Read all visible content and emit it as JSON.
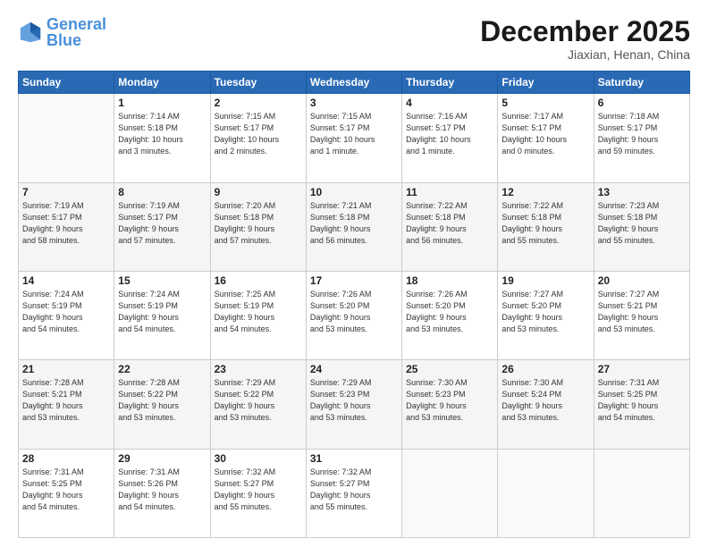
{
  "logo": {
    "line1": "General",
    "line2": "Blue"
  },
  "title": "December 2025",
  "subtitle": "Jiaxian, Henan, China",
  "weekdays": [
    "Sunday",
    "Monday",
    "Tuesday",
    "Wednesday",
    "Thursday",
    "Friday",
    "Saturday"
  ],
  "rows": [
    [
      {
        "num": "",
        "detail": ""
      },
      {
        "num": "1",
        "detail": "Sunrise: 7:14 AM\nSunset: 5:18 PM\nDaylight: 10 hours\nand 3 minutes."
      },
      {
        "num": "2",
        "detail": "Sunrise: 7:15 AM\nSunset: 5:17 PM\nDaylight: 10 hours\nand 2 minutes."
      },
      {
        "num": "3",
        "detail": "Sunrise: 7:15 AM\nSunset: 5:17 PM\nDaylight: 10 hours\nand 1 minute."
      },
      {
        "num": "4",
        "detail": "Sunrise: 7:16 AM\nSunset: 5:17 PM\nDaylight: 10 hours\nand 1 minute."
      },
      {
        "num": "5",
        "detail": "Sunrise: 7:17 AM\nSunset: 5:17 PM\nDaylight: 10 hours\nand 0 minutes."
      },
      {
        "num": "6",
        "detail": "Sunrise: 7:18 AM\nSunset: 5:17 PM\nDaylight: 9 hours\nand 59 minutes."
      }
    ],
    [
      {
        "num": "7",
        "detail": "Sunrise: 7:19 AM\nSunset: 5:17 PM\nDaylight: 9 hours\nand 58 minutes."
      },
      {
        "num": "8",
        "detail": "Sunrise: 7:19 AM\nSunset: 5:17 PM\nDaylight: 9 hours\nand 57 minutes."
      },
      {
        "num": "9",
        "detail": "Sunrise: 7:20 AM\nSunset: 5:18 PM\nDaylight: 9 hours\nand 57 minutes."
      },
      {
        "num": "10",
        "detail": "Sunrise: 7:21 AM\nSunset: 5:18 PM\nDaylight: 9 hours\nand 56 minutes."
      },
      {
        "num": "11",
        "detail": "Sunrise: 7:22 AM\nSunset: 5:18 PM\nDaylight: 9 hours\nand 56 minutes."
      },
      {
        "num": "12",
        "detail": "Sunrise: 7:22 AM\nSunset: 5:18 PM\nDaylight: 9 hours\nand 55 minutes."
      },
      {
        "num": "13",
        "detail": "Sunrise: 7:23 AM\nSunset: 5:18 PM\nDaylight: 9 hours\nand 55 minutes."
      }
    ],
    [
      {
        "num": "14",
        "detail": "Sunrise: 7:24 AM\nSunset: 5:19 PM\nDaylight: 9 hours\nand 54 minutes."
      },
      {
        "num": "15",
        "detail": "Sunrise: 7:24 AM\nSunset: 5:19 PM\nDaylight: 9 hours\nand 54 minutes."
      },
      {
        "num": "16",
        "detail": "Sunrise: 7:25 AM\nSunset: 5:19 PM\nDaylight: 9 hours\nand 54 minutes."
      },
      {
        "num": "17",
        "detail": "Sunrise: 7:26 AM\nSunset: 5:20 PM\nDaylight: 9 hours\nand 53 minutes."
      },
      {
        "num": "18",
        "detail": "Sunrise: 7:26 AM\nSunset: 5:20 PM\nDaylight: 9 hours\nand 53 minutes."
      },
      {
        "num": "19",
        "detail": "Sunrise: 7:27 AM\nSunset: 5:20 PM\nDaylight: 9 hours\nand 53 minutes."
      },
      {
        "num": "20",
        "detail": "Sunrise: 7:27 AM\nSunset: 5:21 PM\nDaylight: 9 hours\nand 53 minutes."
      }
    ],
    [
      {
        "num": "21",
        "detail": "Sunrise: 7:28 AM\nSunset: 5:21 PM\nDaylight: 9 hours\nand 53 minutes."
      },
      {
        "num": "22",
        "detail": "Sunrise: 7:28 AM\nSunset: 5:22 PM\nDaylight: 9 hours\nand 53 minutes."
      },
      {
        "num": "23",
        "detail": "Sunrise: 7:29 AM\nSunset: 5:22 PM\nDaylight: 9 hours\nand 53 minutes."
      },
      {
        "num": "24",
        "detail": "Sunrise: 7:29 AM\nSunset: 5:23 PM\nDaylight: 9 hours\nand 53 minutes."
      },
      {
        "num": "25",
        "detail": "Sunrise: 7:30 AM\nSunset: 5:23 PM\nDaylight: 9 hours\nand 53 minutes."
      },
      {
        "num": "26",
        "detail": "Sunrise: 7:30 AM\nSunset: 5:24 PM\nDaylight: 9 hours\nand 53 minutes."
      },
      {
        "num": "27",
        "detail": "Sunrise: 7:31 AM\nSunset: 5:25 PM\nDaylight: 9 hours\nand 54 minutes."
      }
    ],
    [
      {
        "num": "28",
        "detail": "Sunrise: 7:31 AM\nSunset: 5:25 PM\nDaylight: 9 hours\nand 54 minutes."
      },
      {
        "num": "29",
        "detail": "Sunrise: 7:31 AM\nSunset: 5:26 PM\nDaylight: 9 hours\nand 54 minutes."
      },
      {
        "num": "30",
        "detail": "Sunrise: 7:32 AM\nSunset: 5:27 PM\nDaylight: 9 hours\nand 55 minutes."
      },
      {
        "num": "31",
        "detail": "Sunrise: 7:32 AM\nSunset: 5:27 PM\nDaylight: 9 hours\nand 55 minutes."
      },
      {
        "num": "",
        "detail": ""
      },
      {
        "num": "",
        "detail": ""
      },
      {
        "num": "",
        "detail": ""
      }
    ]
  ]
}
